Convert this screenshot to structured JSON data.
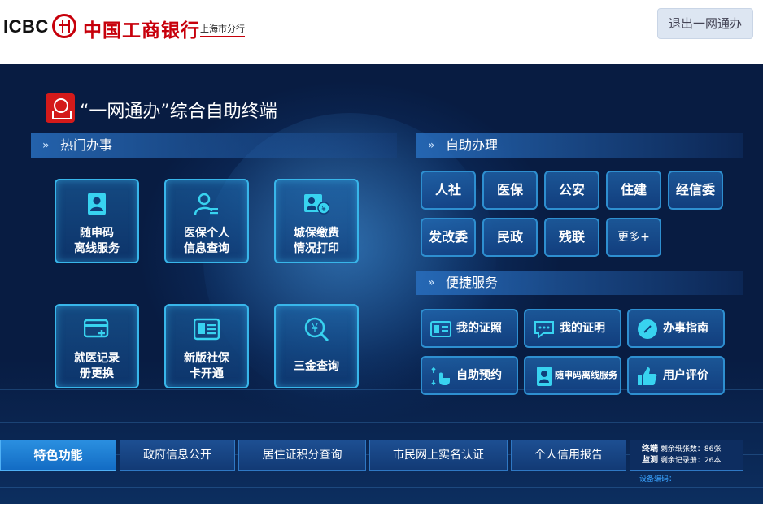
{
  "header": {
    "logo_text": "ICBC",
    "bank_name": "中国工商银行",
    "branch_name": "上海市分行",
    "exit_button": "退出一网通办"
  },
  "terminal": {
    "title": "“一网通办”综合自助终端"
  },
  "hot_section": {
    "title": "热门办事",
    "items": [
      {
        "label": "随申码\n离线服务",
        "icon": "id-card-icon"
      },
      {
        "label": "医保个人\n信息查询",
        "icon": "person-info-icon"
      },
      {
        "label": "城保缴费\n情况打印",
        "icon": "payment-card-icon"
      },
      {
        "label": "就医记录\n册更换",
        "icon": "card-plus-icon"
      },
      {
        "label": "新版社保\n卡开通",
        "icon": "id-card-lines-icon"
      },
      {
        "label": "三金查询",
        "icon": "yen-search-icon"
      }
    ]
  },
  "self_section": {
    "title": "自助办理",
    "departments": [
      "人社",
      "医保",
      "公安",
      "住建",
      "经信委",
      "发改委",
      "民政",
      "残联",
      "更多+"
    ]
  },
  "quick_section": {
    "title": "便捷服务",
    "items": [
      {
        "label": "我的证照",
        "icon": "license-icon"
      },
      {
        "label": "我的证明",
        "icon": "chat-bubble-icon"
      },
      {
        "label": "办事指南",
        "icon": "compass-icon"
      },
      {
        "label": "自助预约",
        "icon": "touch-hand-icon"
      },
      {
        "label": "随申码离线服务",
        "icon": "id-card-icon"
      },
      {
        "label": "用户评价",
        "icon": "thumbs-up-icon"
      }
    ]
  },
  "bottom_tabs": [
    "特色功能",
    "政府信息公开",
    "居住证积分查询",
    "市民网上实名认证",
    "个人信用报告"
  ],
  "status": {
    "line1_key": "终端",
    "line1_text": "剩余纸张数：86张",
    "line2_key": "监测",
    "line2_text": "剩余记录册：26本",
    "device_code": "设备编码："
  },
  "colors": {
    "brand_red": "#c7000b",
    "panel_blue": "#0a2450",
    "accent_cyan": "#38b6ea"
  }
}
